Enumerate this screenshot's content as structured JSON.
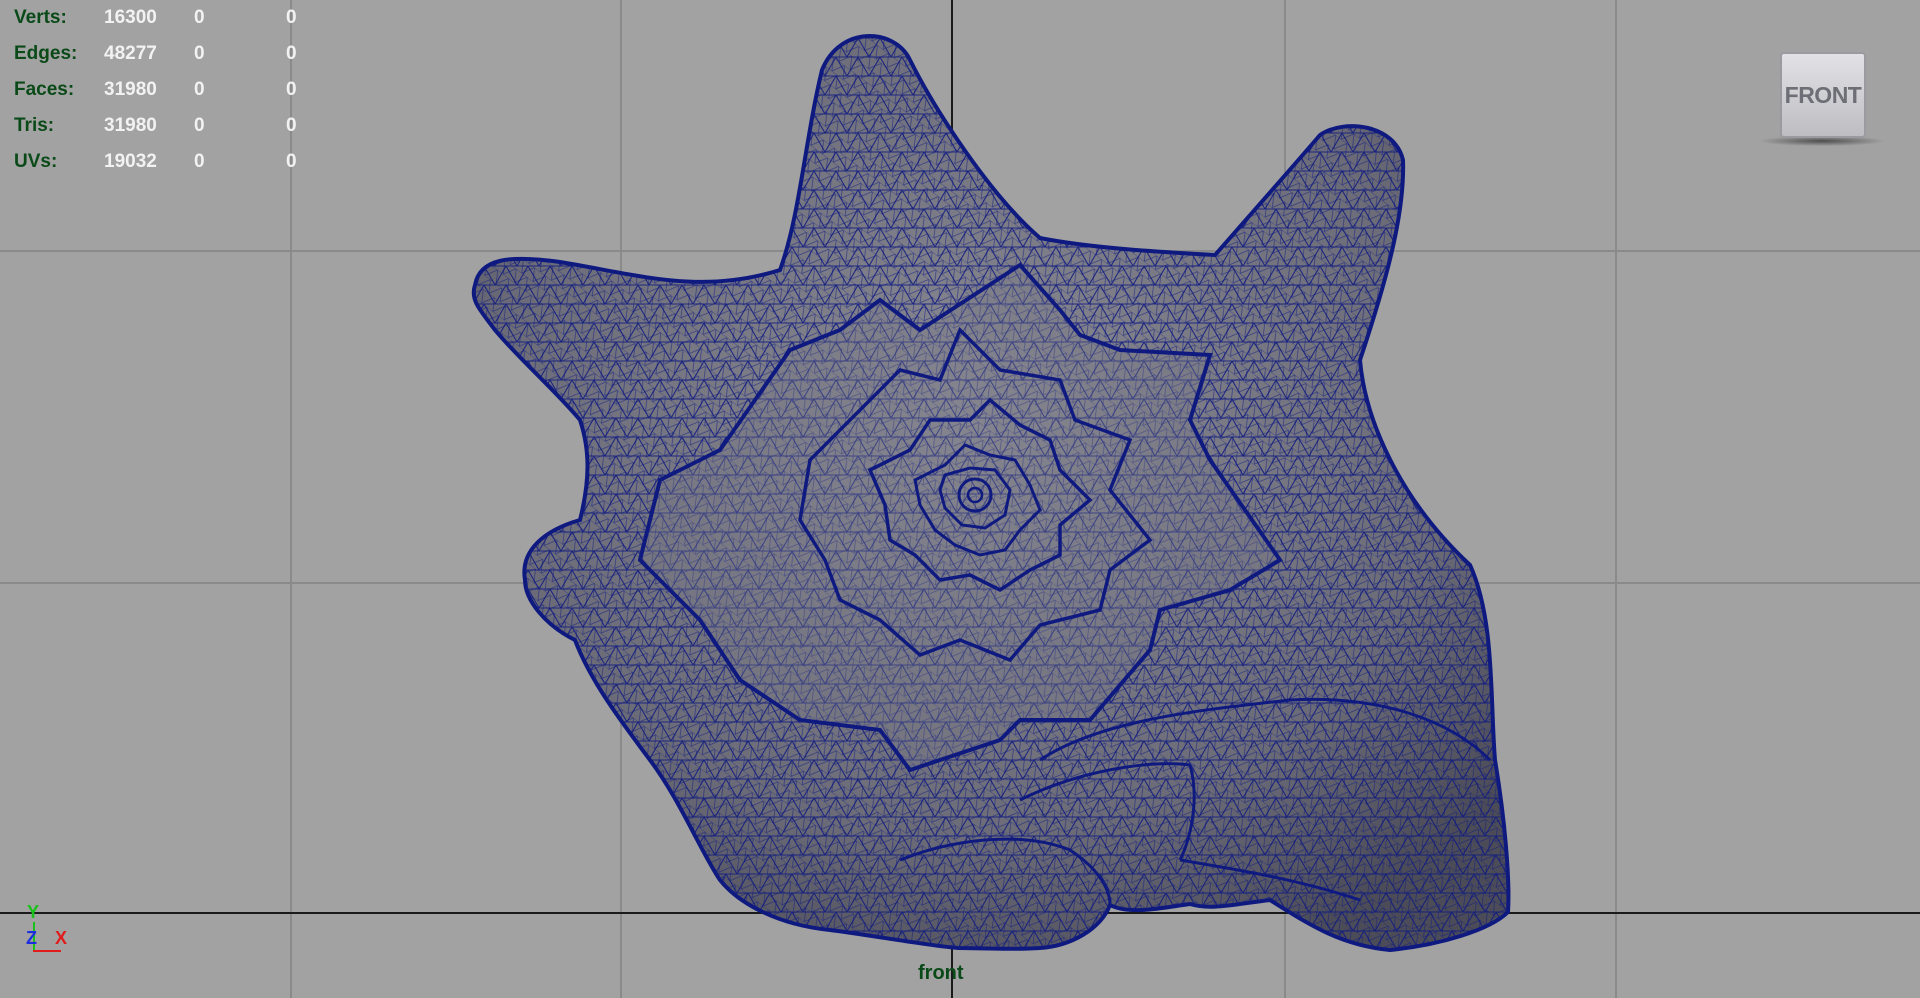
{
  "viewport": {
    "camera": "front",
    "view_cube_label": "FRONT",
    "background_color": "#a2a2a2",
    "wireframe_color": "#0f1a80"
  },
  "hud": {
    "rows": [
      {
        "label": "Verts:",
        "v1": "16300",
        "v2": "0",
        "v3": "0"
      },
      {
        "label": "Edges:",
        "v1": "48277",
        "v2": "0",
        "v3": "0"
      },
      {
        "label": "Faces:",
        "v1": "31980",
        "v2": "0",
        "v3": "0"
      },
      {
        "label": "Tris:",
        "v1": "31980",
        "v2": "0",
        "v3": "0"
      },
      {
        "label": "UVs:",
        "v1": "19032",
        "v2": "0",
        "v3": "0"
      }
    ]
  },
  "axis_gizmo": {
    "y": "Y",
    "z": "Z",
    "x": "X"
  }
}
